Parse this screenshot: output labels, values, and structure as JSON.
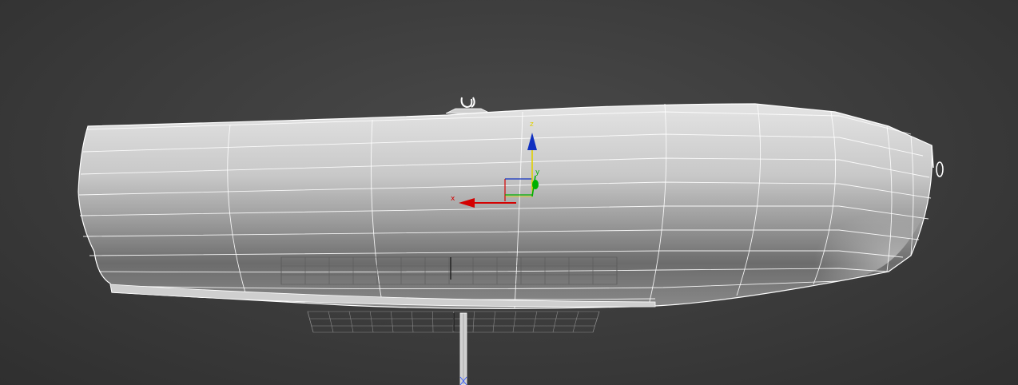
{
  "viewport": {
    "gizmo": {
      "x_label": "x",
      "y_label": "y",
      "z_label": "z",
      "x_color": "#d40000",
      "y_color": "#00b000",
      "z_color": "#1030c0",
      "plane_color": "#e0d000"
    },
    "colors": {
      "background_center": "#4a4a4a",
      "background_edge": "#2f2f2f",
      "mesh_light": "#dedede",
      "mesh_dark": "#6f6f6f",
      "wire": "#ffffff",
      "grid": "#8a8a8a"
    }
  }
}
